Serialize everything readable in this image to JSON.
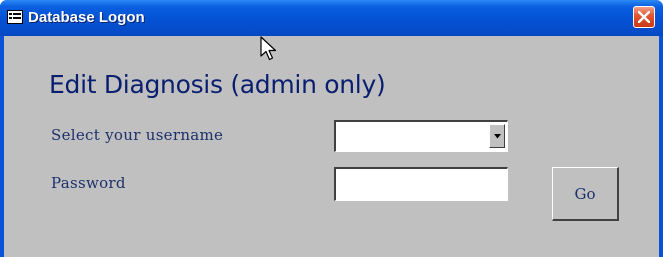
{
  "window": {
    "title": "Database Logon",
    "icons": {
      "app": "form-icon",
      "close": "close-icon"
    },
    "colors": {
      "titlebar": "#0452d4",
      "client": "#c0c0c0",
      "close": "#e0532e",
      "text": "#0a1e70"
    }
  },
  "form": {
    "heading": "Edit Diagnosis (admin only)",
    "username_label": "Select your username",
    "username_value": "",
    "password_label": "Password",
    "password_value": "",
    "go_label": "Go"
  },
  "cursor": {
    "icon": "mouse-pointer-icon"
  }
}
